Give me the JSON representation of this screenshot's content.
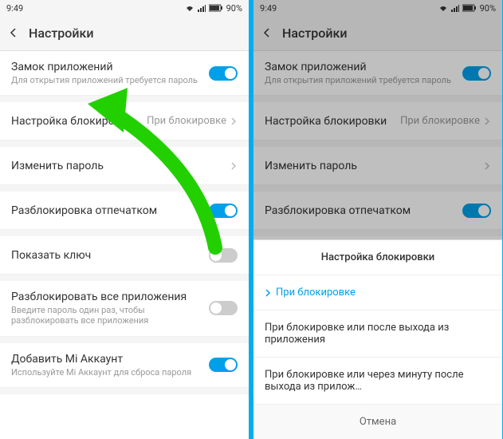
{
  "statusbar": {
    "time": "9:49",
    "battery": "90%"
  },
  "header": {
    "title": "Настройки"
  },
  "rows": {
    "lock_apps": {
      "title": "Замок приложений",
      "sub": "Для открытия приложений требуется пароль"
    },
    "lock_setting": {
      "title": "Настройка блокировки",
      "value": "При блокировке"
    },
    "change_pw": {
      "title": "Изменить пароль"
    },
    "fingerprint": {
      "title": "Разблокировка отпечатком"
    },
    "show_key": {
      "title": "Показать ключ"
    },
    "unlock_all": {
      "title": "Разблокировать все приложения",
      "sub": "Введите пароль один раз, чтобы разблокировать все приложения"
    },
    "mi_account": {
      "title": "Добавить Mi Аккаунт",
      "sub": "Используйте Mi Аккаунт для сброса пароля"
    }
  },
  "sheet": {
    "title": "Настройка блокировки",
    "opt1": "При блокировке",
    "opt2": "При блокировке или после выхода из приложения",
    "opt3": "При блокировке или через минуту после выхода из прилож…",
    "cancel": "Отмена"
  }
}
